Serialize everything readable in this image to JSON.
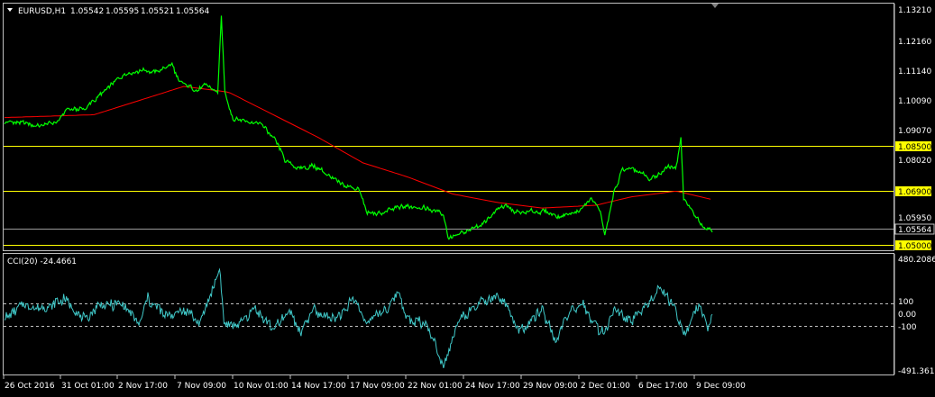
{
  "main_panel": {
    "symbol_label": "EURUSD,H1",
    "ohlc": [
      "1.05542",
      "1.05595",
      "1.05521",
      "1.05564"
    ],
    "price_ticks": [
      "1.13210",
      "1.12160",
      "1.11140",
      "1.10090",
      "1.09070",
      "1.08020",
      "1.05950"
    ],
    "horizontal_levels": [
      {
        "value": 1.085,
        "label": "1.08500",
        "color": "#ffff00"
      },
      {
        "value": 1.069,
        "label": "1.06900",
        "color": "#ffff00"
      },
      {
        "value": 1.05,
        "label": "1.05000",
        "color": "#ffff00"
      }
    ],
    "current_price_label": "1.05564",
    "price_series": {
      "name": "EURUSD",
      "color": "#00ff00"
    },
    "ma_series": {
      "color": "#ff0000"
    }
  },
  "cci_panel": {
    "label": "CCI(20) -24.4661",
    "series_color": "#40c8c8",
    "ticks": [
      "480.2086",
      "100",
      "0.00",
      "-100",
      "-491.3611"
    ],
    "levels": [
      100,
      -100
    ]
  },
  "time_axis": {
    "labels": [
      "26 Oct 2016",
      "31 Oct 01:00",
      "2 Nov 17:00",
      "7 Nov 09:00",
      "10 Nov 01:00",
      "14 Nov 17:00",
      "17 Nov 09:00",
      "22 Nov 01:00",
      "24 Nov 17:00",
      "29 Nov 09:00",
      "2 Dec 01:00",
      "6 Dec 17:00",
      "9 Dec 09:00"
    ]
  },
  "chart_data": {
    "type": "line",
    "title": "EURUSD,H1",
    "ylim": [
      1.05,
      1.1321
    ],
    "price_anchors": [
      [
        0,
        1.0935
      ],
      [
        20,
        1.093
      ],
      [
        40,
        1.092
      ],
      [
        60,
        1.0935
      ],
      [
        70,
        1.098
      ],
      [
        90,
        1.098
      ],
      [
        100,
        1.101
      ],
      [
        115,
        1.105
      ],
      [
        135,
        1.111
      ],
      [
        155,
        1.112
      ],
      [
        170,
        1.111
      ],
      [
        187,
        1.114
      ],
      [
        195,
        1.107
      ],
      [
        205,
        1.106
      ],
      [
        215,
        1.105
      ],
      [
        225,
        1.106
      ],
      [
        238,
        1.104
      ],
      [
        242,
        1.13
      ],
      [
        246,
        1.104
      ],
      [
        255,
        1.095
      ],
      [
        270,
        1.094
      ],
      [
        285,
        1.093
      ],
      [
        300,
        1.088
      ],
      [
        315,
        1.079
      ],
      [
        330,
        1.077
      ],
      [
        345,
        1.078
      ],
      [
        360,
        1.075
      ],
      [
        375,
        1.071
      ],
      [
        395,
        1.07
      ],
      [
        405,
        1.061
      ],
      [
        420,
        1.061
      ],
      [
        440,
        1.063
      ],
      [
        460,
        1.064
      ],
      [
        490,
        1.061
      ],
      [
        495,
        1.053
      ],
      [
        515,
        1.054
      ],
      [
        535,
        1.058
      ],
      [
        555,
        1.064
      ],
      [
        575,
        1.061
      ],
      [
        600,
        1.062
      ],
      [
        620,
        1.06
      ],
      [
        640,
        1.062
      ],
      [
        655,
        1.066
      ],
      [
        665,
        1.062
      ],
      [
        670,
        1.053
      ],
      [
        680,
        1.068
      ],
      [
        690,
        1.077
      ],
      [
        705,
        1.076
      ],
      [
        720,
        1.073
      ],
      [
        740,
        1.077
      ],
      [
        750,
        1.078
      ],
      [
        755,
        1.087
      ],
      [
        758,
        1.066
      ],
      [
        770,
        1.061
      ],
      [
        780,
        1.057
      ],
      [
        790,
        1.0556
      ]
    ],
    "ma_anchors": [
      [
        0,
        1.095
      ],
      [
        100,
        1.096
      ],
      [
        200,
        1.106
      ],
      [
        250,
        1.104
      ],
      [
        300,
        1.096
      ],
      [
        350,
        1.088
      ],
      [
        400,
        1.079
      ],
      [
        450,
        1.074
      ],
      [
        500,
        1.068
      ],
      [
        550,
        1.065
      ],
      [
        600,
        1.063
      ],
      [
        660,
        1.064
      ],
      [
        700,
        1.067
      ],
      [
        750,
        1.069
      ],
      [
        790,
        1.066
      ]
    ],
    "cci_range": [
      -491.3611,
      480.2086
    ],
    "cci_anchors": [
      [
        0,
        -40
      ],
      [
        20,
        100
      ],
      [
        40,
        40
      ],
      [
        65,
        150
      ],
      [
        90,
        -50
      ],
      [
        105,
        80
      ],
      [
        130,
        90
      ],
      [
        150,
        -80
      ],
      [
        160,
        140
      ],
      [
        180,
        -10
      ],
      [
        200,
        40
      ],
      [
        220,
        -60
      ],
      [
        240,
        420
      ],
      [
        245,
        -80
      ],
      [
        260,
        -100
      ],
      [
        280,
        60
      ],
      [
        300,
        -130
      ],
      [
        320,
        30
      ],
      [
        330,
        -170
      ],
      [
        345,
        40
      ],
      [
        370,
        -40
      ],
      [
        390,
        140
      ],
      [
        405,
        -60
      ],
      [
        430,
        80
      ],
      [
        440,
        210
      ],
      [
        450,
        -40
      ],
      [
        470,
        -70
      ],
      [
        490,
        -430
      ],
      [
        510,
        -20
      ],
      [
        530,
        110
      ],
      [
        555,
        150
      ],
      [
        575,
        -150
      ],
      [
        600,
        50
      ],
      [
        615,
        -230
      ],
      [
        630,
        10
      ],
      [
        645,
        100
      ],
      [
        660,
        -110
      ],
      [
        670,
        -170
      ],
      [
        680,
        50
      ],
      [
        700,
        -60
      ],
      [
        715,
        80
      ],
      [
        730,
        230
      ],
      [
        745,
        100
      ],
      [
        760,
        -180
      ],
      [
        775,
        80
      ],
      [
        785,
        -110
      ],
      [
        790,
        -24.4661
      ]
    ]
  }
}
